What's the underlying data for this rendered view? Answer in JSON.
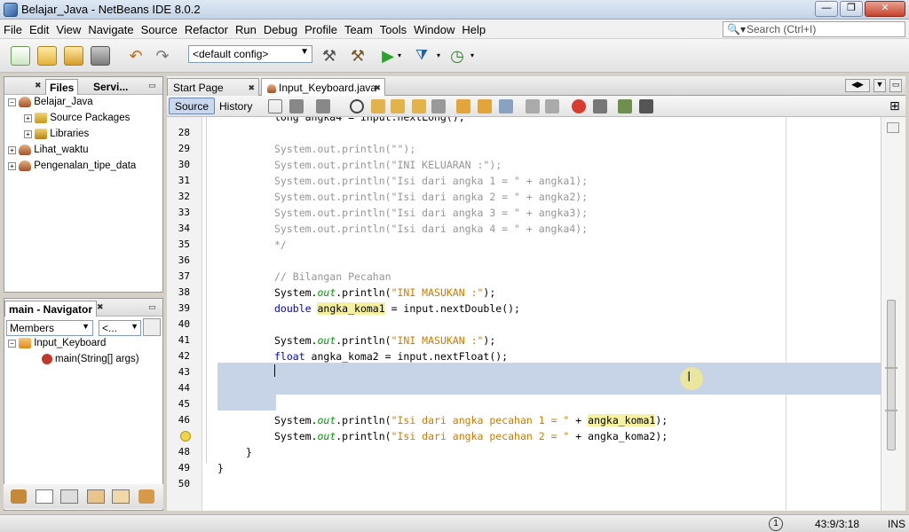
{
  "window": {
    "title": "Belajar_Java - NetBeans IDE 8.0.2",
    "buttons": [
      "—",
      "❐",
      "✕"
    ]
  },
  "menubar": {
    "items": [
      "File",
      "Edit",
      "View",
      "Navigate",
      "Source",
      "Refactor",
      "Run",
      "Debug",
      "Profile",
      "Team",
      "Tools",
      "Window",
      "Help"
    ]
  },
  "search": {
    "placeholder": "Search (Ctrl+I)"
  },
  "toolbar": {
    "config": "<default config>"
  },
  "projects_panel": {
    "tabs": [
      "Files",
      "Servi..."
    ],
    "tree": [
      {
        "label": "Belajar_Java",
        "icon": "coffee-cup-icon"
      },
      {
        "label": "Source Packages",
        "icon": "package-icon"
      },
      {
        "label": "Libraries",
        "icon": "library-icon"
      },
      {
        "label": "Lihat_waktu",
        "icon": "coffee-cup-icon"
      },
      {
        "label": "Pengenalan_tipe_data",
        "icon": "coffee-cup-icon"
      }
    ]
  },
  "navigator_panel": {
    "title": "main - Navigator",
    "members_select": "Members",
    "filter_select": "<...",
    "tree": [
      {
        "label": "Input_Keyboard",
        "icon": "class-icon"
      },
      {
        "label": "main(String[] args)",
        "icon": "method-icon"
      }
    ]
  },
  "editor": {
    "tabs": [
      "Start Page",
      "Input_Keyboard.java"
    ],
    "source_tab": "Source",
    "history_tab": "History",
    "partial_top_line": "long angka4 = input.nextLong();",
    "line_numbers": [
      "28",
      "29",
      "30",
      "31",
      "32",
      "33",
      "34",
      "35",
      "36",
      "37",
      "38",
      "39",
      "40",
      "41",
      "42",
      "43",
      "44",
      "45",
      "46",
      "47",
      "48",
      "49",
      "50"
    ],
    "lines": {
      "l29": "System.out.println(\"\");",
      "l30": "System.out.println(\"INI KELUARAN :\");",
      "l31": "System.out.println(\"Isi dari angka 1 = \" + angka1);",
      "l32": "System.out.println(\"Isi dari angka 2 = \" + angka2);",
      "l33": "System.out.println(\"Isi dari angka 3 = \" + angka3);",
      "l34": "System.out.println(\"Isi dari angka 4 = \" + angka4);",
      "l35": "*/",
      "l37": "// Bilangan Pecahan",
      "sysout": "System.",
      "out": "out",
      "println": ".println(",
      "s_masukan": "\"INI MASUKAN :\"",
      "close": ");",
      "kw_double": "double",
      "angka_koma1": "angka_koma1",
      "eq_nextDouble": " = input.nextDouble();",
      "kw_float": "float",
      "l42_rest": " angka_koma2 = input.nextFloat();",
      "s_pecahan1": "\"Isi dari angka pecahan 1 = \"",
      "s_pecahan2": "\"Isi dari angka pecahan 2 = \"",
      "plus": " + ",
      "angka_koma2": "angka_koma2",
      "l48": "}",
      "l49": "}"
    }
  },
  "status": {
    "position": "43:9/3:18",
    "mode": "INS",
    "notifications": "1"
  }
}
